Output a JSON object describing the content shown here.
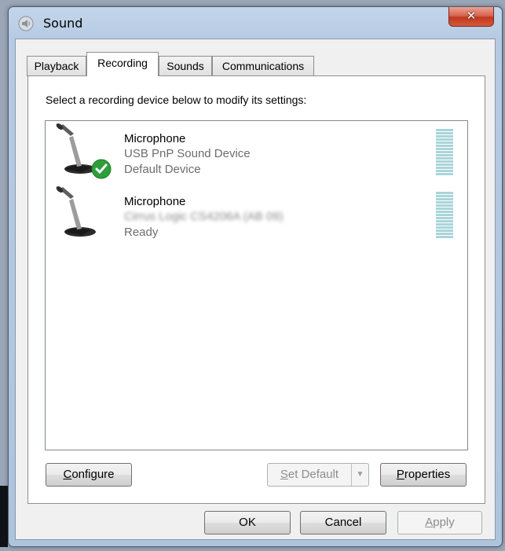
{
  "window": {
    "title": "Sound",
    "close_glyph": "✕",
    "icon": "speaker-icon"
  },
  "tabs": [
    {
      "label": "Playback",
      "active": false
    },
    {
      "label": "Recording",
      "active": true
    },
    {
      "label": "Sounds",
      "active": false
    },
    {
      "label": "Communications",
      "active": false
    }
  ],
  "recording": {
    "instruction": "Select a recording device below to modify its settings:",
    "devices": [
      {
        "name": "Microphone",
        "description": "USB PnP Sound Device",
        "status": "Default Device",
        "is_default": true,
        "icon": "microphone-icon"
      },
      {
        "name": "Microphone",
        "description": "Cirrus Logic CS4206A (AB 09)",
        "status": "Ready",
        "is_default": false,
        "icon": "microphone-icon"
      }
    ],
    "buttons": {
      "configure": {
        "underline": "C",
        "rest": "onfigure"
      },
      "set_default": {
        "underline": "S",
        "rest": "et Default",
        "disabled": true
      },
      "properties": {
        "underline": "P",
        "rest": "roperties"
      }
    }
  },
  "footer": {
    "ok": "OK",
    "cancel": "Cancel",
    "apply": {
      "underline": "A",
      "rest": "pply",
      "disabled": true
    }
  },
  "colors": {
    "meter": "#a9d5d9",
    "default_check": "#2e9e3a",
    "close_button": "#c1381f"
  }
}
